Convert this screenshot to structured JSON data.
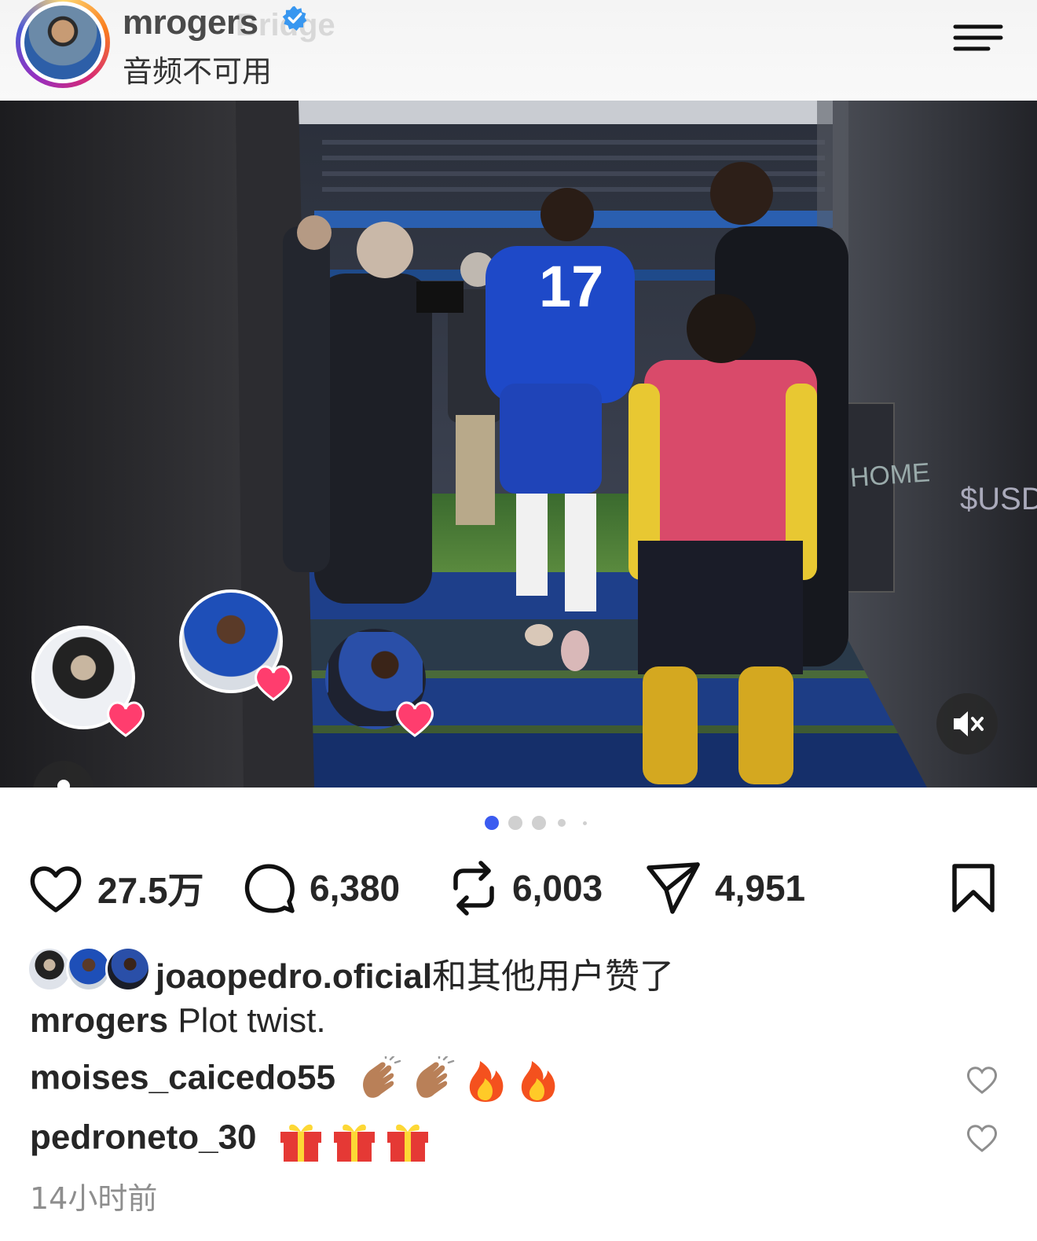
{
  "header": {
    "username": "mrogers",
    "subtitle": "音频不可用",
    "ghost_text": "Bridge"
  },
  "post": {
    "carousel_total": 5,
    "carousel_active": 1,
    "liked_avatars": [
      "joaopedro.oficial",
      "user2",
      "user3"
    ]
  },
  "actions": {
    "likes": "27.5万",
    "comments": "6,380",
    "reposts": "6,003",
    "shares": "4,951"
  },
  "liked_by": {
    "user": "joaopedro.oficial",
    "suffix": "和其他用户赞了"
  },
  "caption": {
    "user": "mrogers",
    "text": "Plot twist."
  },
  "comments": [
    {
      "user": "moises_caicedo55",
      "emojis": [
        "clap",
        "clap",
        "fire",
        "fire"
      ]
    },
    {
      "user": "pedroneto_30",
      "emojis": [
        "gift",
        "gift",
        "gift"
      ]
    }
  ],
  "timestamp": "14小时前",
  "colors": {
    "verified": "#3897f0",
    "pager_active": "#3b5bf0",
    "heart_badge": "#ff3d6e"
  },
  "icons": {
    "like": "heart-icon",
    "comment": "comment-icon",
    "repost": "repost-icon",
    "share": "share-icon",
    "save": "bookmark-icon",
    "mute": "speaker-muted-icon"
  }
}
